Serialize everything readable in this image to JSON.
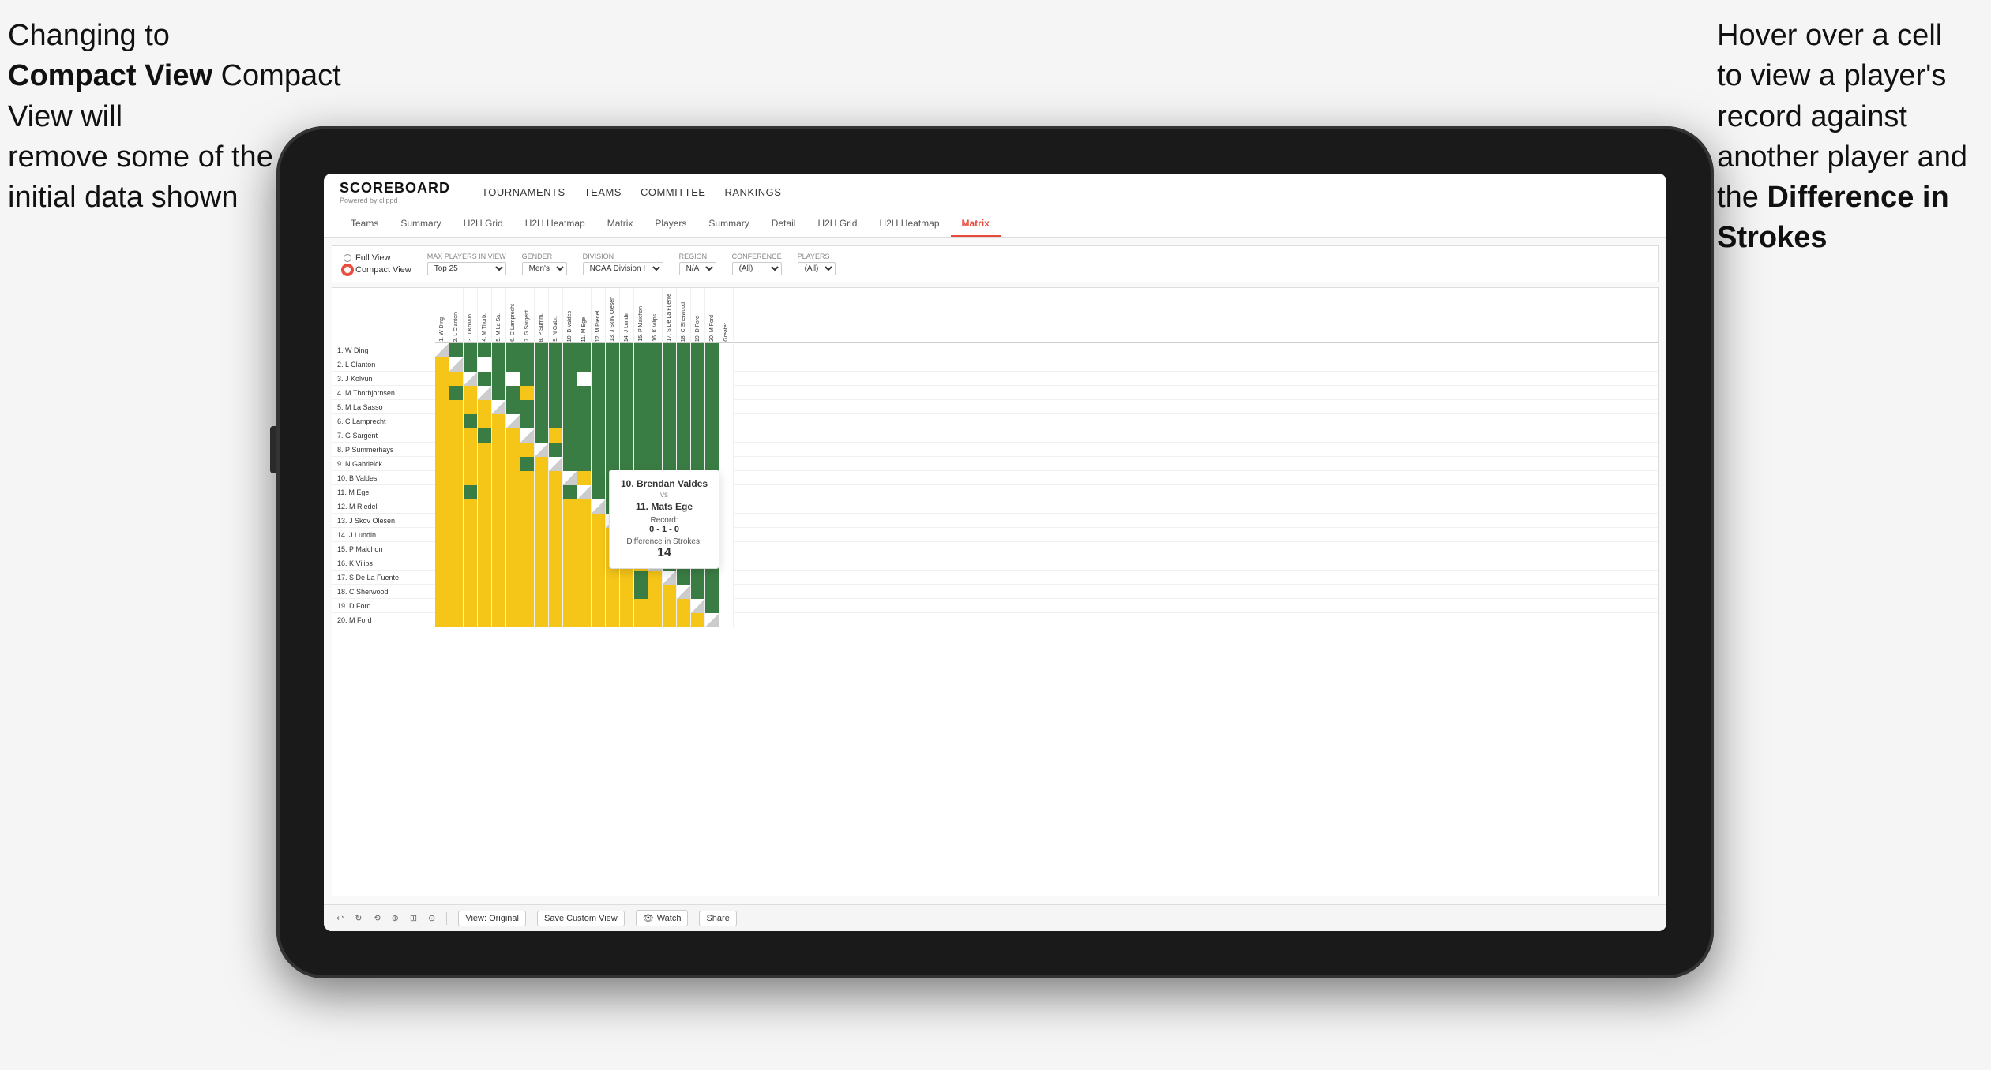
{
  "annotations": {
    "left_line1": "Changing to",
    "left_line2": "Compact View will",
    "left_line3": "remove some of the",
    "left_line4": "initial data shown",
    "right_line1": "Hover over a cell",
    "right_line2": "to view a player's",
    "right_line3": "record against",
    "right_line4": "another player and",
    "right_line5": "the ",
    "right_bold": "Difference in Strokes"
  },
  "nav": {
    "logo": "SCOREBOARD",
    "logo_sub": "Powered by clippd",
    "links": [
      "TOURNAMENTS",
      "TEAMS",
      "COMMITTEE",
      "RANKINGS"
    ]
  },
  "sub_nav": {
    "tabs": [
      "Teams",
      "Summary",
      "H2H Grid",
      "H2H Heatmap",
      "Matrix",
      "Players",
      "Summary",
      "Detail",
      "H2H Grid",
      "H2H Heatmap",
      "Matrix"
    ],
    "active": "Matrix"
  },
  "filters": {
    "view_full": "Full View",
    "view_compact": "Compact View",
    "max_players_label": "Max players in view",
    "max_players_value": "Top 25",
    "gender_label": "Gender",
    "gender_value": "Men's",
    "division_label": "Division",
    "division_value": "NCAA Division I",
    "region_label": "Region",
    "region_value": "N/A",
    "conference_label": "Conference",
    "conference_value": "(All)",
    "players_label": "Players",
    "players_value": "(All)"
  },
  "players": [
    "1. W Ding",
    "2. L Clanton",
    "3. J Kolvun",
    "4. M Thorbjornsen",
    "5. M La Sasso",
    "6. C Lamprecht",
    "7. G Sargent",
    "8. P Summerhays",
    "9. N Gabrielck",
    "10. B Valdes",
    "11. M Ege",
    "12. M Riedel",
    "13. J Skov Olesen",
    "14. J Lundin",
    "15. P Maichon",
    "16. K Vilips",
    "17. S De La Fuente",
    "18. C Sherwood",
    "19. D Ford",
    "20. M Ford"
  ],
  "col_headers": [
    "1. W Ding",
    "2. L Clanton",
    "3. J Kolvun",
    "4. M Thorb.",
    "5. M La Sa.",
    "6. C Lamprecht",
    "7. G Sargent",
    "8. P Summ.",
    "9. N Gabr.",
    "10. B Valdes",
    "11. M Ege",
    "12. M Riedel",
    "13. J Skov Olesen",
    "14. J Lundin",
    "15. P Maichon",
    "16. K Vilips",
    "17. S De La Fuente",
    "18. C Sherwood",
    "19. D Ford",
    "20. M Ford",
    "Greater"
  ],
  "tooltip": {
    "player1": "10. Brendan Valdes",
    "vs": "vs",
    "player2": "11. Mats Ege",
    "record_label": "Record:",
    "record_value": "0 - 1 - 0",
    "diff_label": "Difference in Strokes:",
    "diff_value": "14"
  },
  "toolbar": {
    "view_original": "View: Original",
    "save_custom": "Save Custom View",
    "watch": "Watch",
    "share": "Share"
  }
}
